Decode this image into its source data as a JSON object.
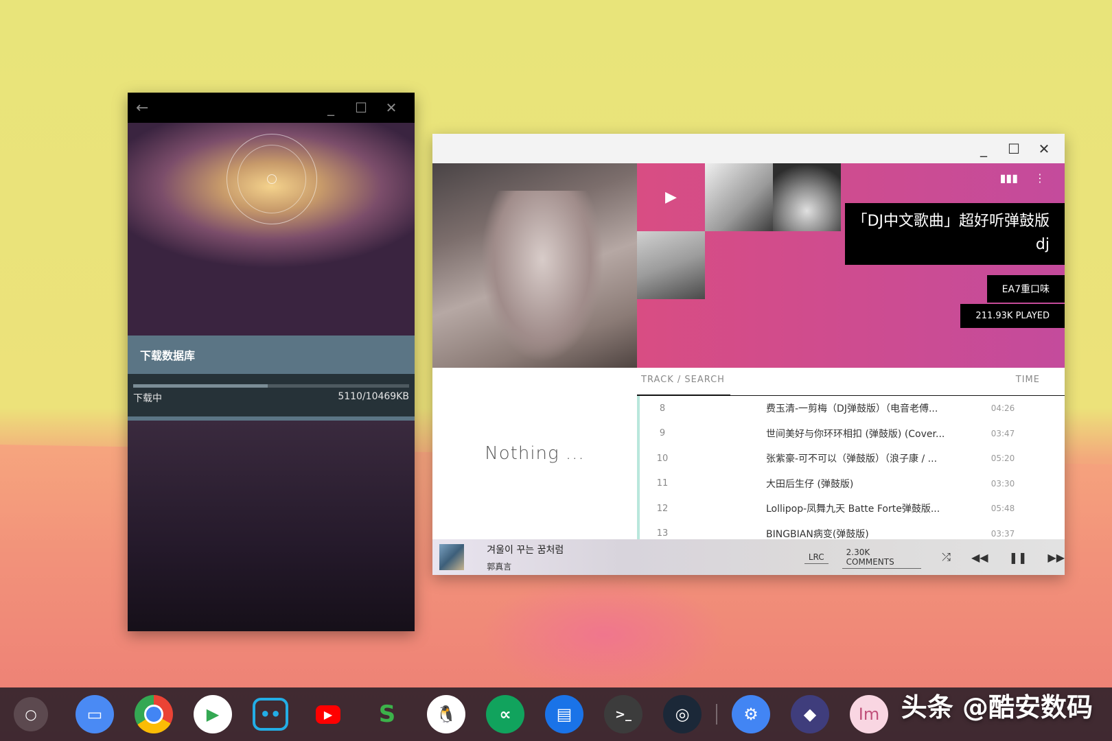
{
  "download_window": {
    "back_icon": "back-arrow-icon",
    "dialog_title": "下载数据库",
    "status_label": "下载中",
    "progress_text": "5110/10469KB",
    "progress_fraction": 0.488
  },
  "music_window": {
    "playlist_title": "「DJ中文歌曲」超好听弹鼓版dj",
    "artist": "EA7重口味",
    "played": "211.93K PLAYED",
    "empty_text": "Nothing ...",
    "columns": {
      "track": "TRACK / SEARCH",
      "time": "TIME"
    },
    "tracks": [
      {
        "num": "8",
        "name": "费玉清-一剪梅（DJ弹鼓版）（电音老傅...",
        "time": "04:26"
      },
      {
        "num": "9",
        "name": "世间美好与你环环相扣 (弹鼓版) (Cover...",
        "time": "03:47"
      },
      {
        "num": "10",
        "name": "张紫豪-可不可以（弹鼓版）（浪子康 / ...",
        "time": "05:20"
      },
      {
        "num": "11",
        "name": "大田后生仔 (弹鼓版)",
        "time": "03:30"
      },
      {
        "num": "12",
        "name": "Lollipop-凤舞九天 Batte Forte弹鼓版...",
        "time": "05:48"
      },
      {
        "num": "13",
        "name": "BINGBIAN病变(弹鼓版)",
        "time": "03:37"
      }
    ],
    "now_playing": {
      "title": "겨울이 꾸는 꿈처럼",
      "artist": "郭真言",
      "lrc": "LRC",
      "comments": "2.30K COMMENTS"
    }
  },
  "shelf": {
    "apps": [
      "files",
      "chrome",
      "play-store",
      "bilibili",
      "youtube",
      "sheets",
      "qq",
      "coolapk",
      "messages",
      "terminal",
      "steam",
      "settings",
      "app-diamond",
      "app-im"
    ]
  },
  "watermark": "头条 @酷安数码"
}
